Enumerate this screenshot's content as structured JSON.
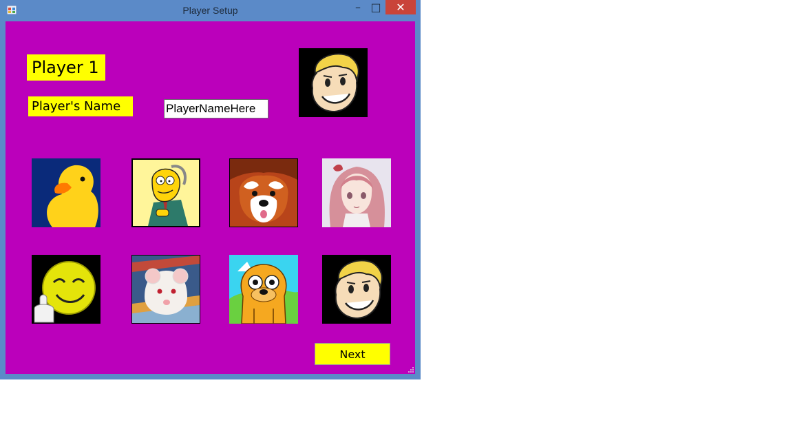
{
  "window": {
    "title": "Player Setup",
    "controls": {
      "minimize": "–",
      "maximize": "□",
      "close": "✕"
    }
  },
  "form": {
    "player_heading": "Player 1",
    "name_label": "Player's Name",
    "name_input": {
      "value": "PlayerNameHere"
    },
    "selected_avatar": "vault-boy",
    "next_label": "Next"
  },
  "avatars": [
    {
      "icon": "rubber-duck"
    },
    {
      "icon": "mr-burns"
    },
    {
      "icon": "red-panda"
    },
    {
      "icon": "anime-girl"
    },
    {
      "icon": "smiley-middle-finger"
    },
    {
      "icon": "white-rat"
    },
    {
      "icon": "jake-the-dog"
    },
    {
      "icon": "vault-boy"
    }
  ],
  "colors": {
    "background": "#bb00bb",
    "label": "#ffff00",
    "titlebar": "#5b8ac8",
    "close": "#c9443a"
  }
}
